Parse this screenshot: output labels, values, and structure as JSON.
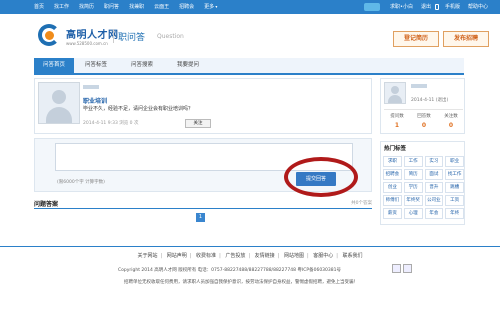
{
  "topbar": {
    "nav": [
      "首页",
      "找工作",
      "找简历",
      "职问答",
      "找兼职",
      "云面王",
      "招聘会",
      "更多"
    ],
    "right": {
      "user_link": "求职•小白",
      "logout": "退出",
      "mobile": "手机版",
      "help": "帮助中心"
    }
  },
  "header": {
    "brand_name": "高明人才网",
    "brand_url": "www.528500.com.cn",
    "section_title": "职问答",
    "section_sub": "Question",
    "btn_login": "登记简历",
    "btn_post": "发布招聘"
  },
  "subnav": {
    "items": [
      "问答首页",
      "问答标签",
      "问答搜索",
      "我要提问"
    ]
  },
  "question": {
    "title": "职业培训",
    "body": "毕业不久，经验不足，请问企业会有职业培训吗？",
    "meta": "2014-4-11 9:33  浏览 0 次",
    "follow": "关注"
  },
  "answer": {
    "hint": "(限6000个字  计算字数)",
    "submit": "提交回答"
  },
  "answers": {
    "title": "问题答案",
    "count": "共0个答案",
    "page": "1"
  },
  "side_user": {
    "date": "2014-4-11  (退出)",
    "stats": [
      {
        "label": "提问数",
        "value": "1"
      },
      {
        "label": "回答数",
        "value": "0"
      },
      {
        "label": "关注数",
        "value": "0"
      }
    ]
  },
  "tags": {
    "title": "热门标签",
    "items": [
      "求职",
      "工作",
      "实习",
      "职业",
      "招聘会",
      "简历",
      "面试",
      "找工作",
      "创业",
      "学历",
      "晋升",
      "跳槽",
      "师傅们",
      "年终奖",
      "公司业",
      "工资",
      "薪资",
      "心理",
      "年会",
      "年终"
    ]
  },
  "footer": {
    "links": [
      "关于网站",
      "网站声明",
      "收费标准",
      "广告投放",
      "友情链接",
      "网站地图",
      "客服中心",
      "联系我们"
    ],
    "copyright": "Copyright 2014 高明人才网 版权所有 电话：0757-88227488/88227788/88227748 粤ICP备06030381号",
    "disclaimer": "招聘单位无权收取任何费用，请求职人员加强自我保护意识，按劳动法保护自身权益，警惕虚假招聘，避免上当受骗！"
  }
}
